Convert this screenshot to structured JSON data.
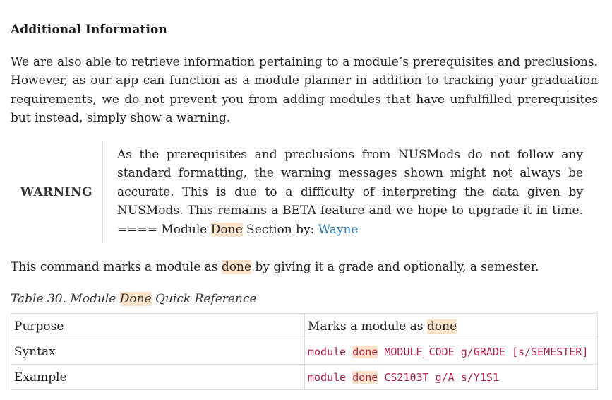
{
  "section": {
    "heading": "Additional Information",
    "intro": "We are also able to retrieve information pertaining to a module’s prerequisites and preclusions. However, as our app can function as a module planner in addition to tracking your graduation requirements, we do not prevent you from adding modules that have unfulfilled prerequisites but instead, simply show a warning."
  },
  "warning": {
    "label": "WARNING",
    "text_before": "As the prerequisites and preclusions from NUSMods do not follow any standard formatting, the warning messages shown might not always be accurate. This is due to a difficulty of interpreting the data given by NUSMods. This remains a BETA feature and we hope to upgrade it in time. ==== Module ",
    "highlight": "Done",
    "text_section_by": " Section by: ",
    "author_link": "Wayne"
  },
  "command": {
    "text_before": "This command marks a module as ",
    "highlight": "done",
    "text_after": " by giving it a grade and optionally, a semester."
  },
  "table": {
    "caption_before": "Table 30. Module ",
    "caption_highlight": "Done",
    "caption_after": " Quick Reference",
    "rows": [
      {
        "label": "Purpose",
        "value_before": "Marks a module as ",
        "value_highlight": "done",
        "value_after": ""
      },
      {
        "label": "Syntax",
        "value_before": "module ",
        "value_highlight": "done",
        "value_after": " MODULE_CODE g/GRADE [s/SEMESTER]"
      },
      {
        "label": "Example",
        "value_before": "module ",
        "value_highlight": "done",
        "value_after": " CS2103T g/A s/Y1S1"
      }
    ]
  },
  "colors": {
    "highlight": "#fde4c8",
    "link": "#2b7bb9",
    "code": "#b12146"
  }
}
